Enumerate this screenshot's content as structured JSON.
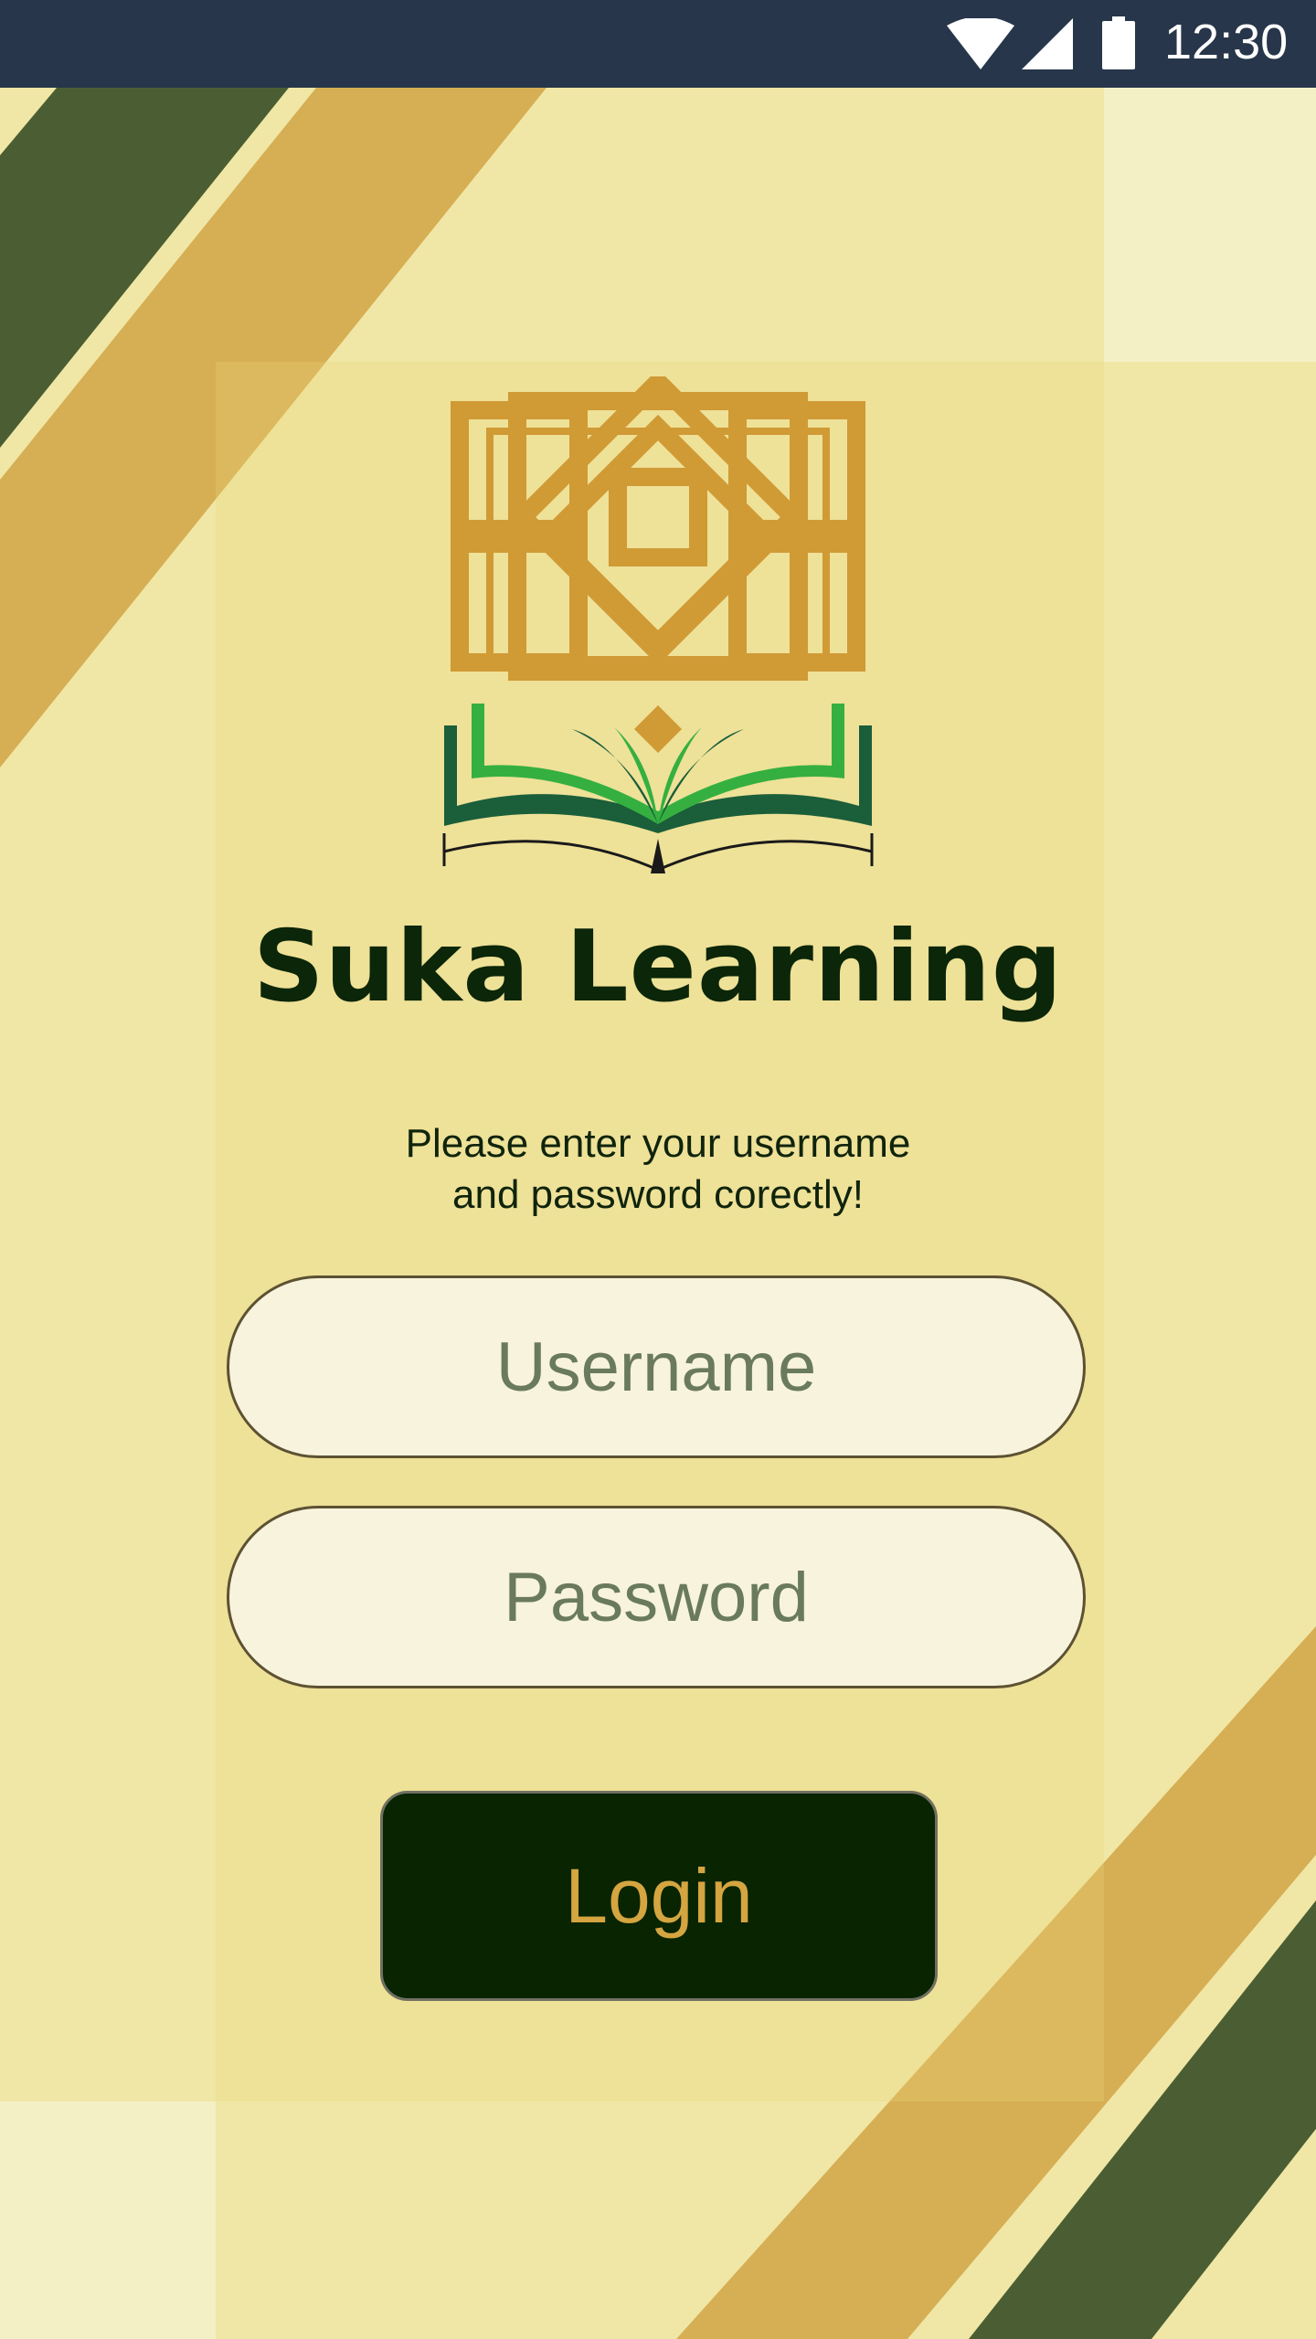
{
  "status_bar": {
    "time": "12:30",
    "icons": [
      "wifi-icon",
      "signal-icon",
      "battery-icon"
    ]
  },
  "app": {
    "title": "Suka Learning",
    "logo": "suka-learning-logo"
  },
  "login_form": {
    "instruction_line1": "Please enter your username",
    "instruction_line2": "and password corectly!",
    "username_placeholder": "Username",
    "password_placeholder": "Password",
    "login_label": "Login"
  },
  "colors": {
    "status_bar": "#27364a",
    "background": "#f0e7a6",
    "stripe_dark_green": "#4b5e33",
    "stripe_gold": "#d6ae54",
    "logo_gold": "#d09a35",
    "logo_dark_green": "#1b5e3a",
    "logo_light_green": "#35b040",
    "title_color": "#0b2608",
    "button_background": "#082401",
    "button_text": "#d4a540"
  }
}
